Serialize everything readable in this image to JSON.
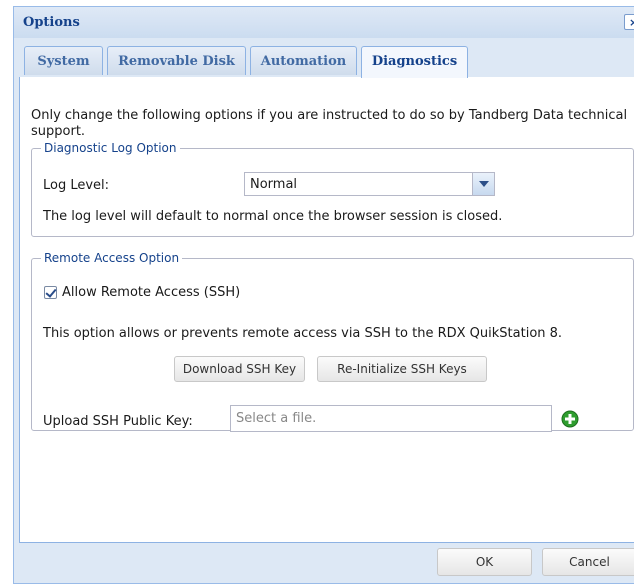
{
  "window": {
    "title": "Options",
    "close_glyph": "×",
    "close_icon": "close-icon"
  },
  "tabs": [
    {
      "label": "System",
      "active": false
    },
    {
      "label": "Removable Disk",
      "active": false
    },
    {
      "label": "Automation",
      "active": false
    },
    {
      "label": "Diagnostics",
      "active": true
    }
  ],
  "intro_text": "Only change the following options if you are instructed to do so by Tandberg Data technical support.",
  "diagnostic_log": {
    "legend": "Diagnostic Log Option",
    "log_level_label": "Log Level:",
    "log_level_value": "Normal",
    "note": "The log level will default to normal once the browser session is closed."
  },
  "remote_access": {
    "legend": "Remote Access Option",
    "allow_label": "Allow Remote Access (SSH)",
    "allow_checked": true,
    "note": "This option allows or prevents remote access via SSH to the RDX QuikStation 8.",
    "download_key_label": "Download SSH Key",
    "reinit_keys_label": "Re-Initialize SSH Keys",
    "upload_label": "Upload SSH Public Key:",
    "upload_placeholder": "Select a file.",
    "add_icon": "add-plus-icon"
  },
  "footer": {
    "ok_label": "OK",
    "cancel_label": "Cancel"
  },
  "colors": {
    "title_text": "#15428b",
    "frame_background": "#dde8f5",
    "frame_border": "#99bbe8",
    "legend_text": "#15428b",
    "add_icon_green": "#2e9d2e"
  }
}
